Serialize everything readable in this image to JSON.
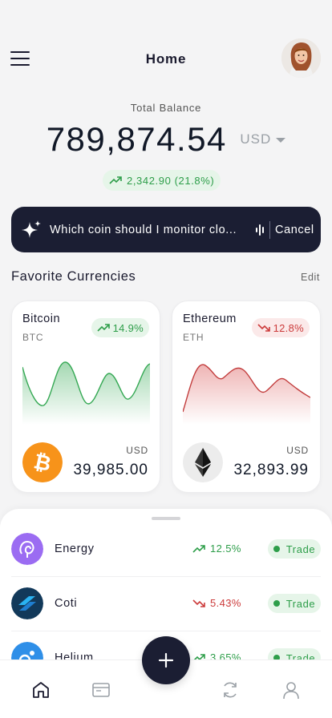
{
  "header": {
    "title": "Home"
  },
  "balance": {
    "label": "Total Balance",
    "amount": "789,874.54",
    "currency": "USD",
    "change": "2,342.90 (21.8%)"
  },
  "assistant": {
    "prompt": "Which coin should I monitor clo...",
    "cancel_label": "Cancel"
  },
  "favorites": {
    "title": "Favorite Currencies",
    "edit_label": "Edit",
    "cards": [
      {
        "name": "Bitcoin",
        "symbol": "BTC",
        "change": "14.9%",
        "trend": "up",
        "currency": "USD",
        "value": "39,985.00",
        "color": "#34a853",
        "icon": "bitcoin-icon"
      },
      {
        "name": "Ethereum",
        "symbol": "ETH",
        "change": "12.8%",
        "trend": "down",
        "currency": "USD",
        "value": "32,893.99",
        "color": "#d64545",
        "icon": "ethereum-icon"
      }
    ]
  },
  "assets": [
    {
      "name": "Energy",
      "change": "12.5%",
      "trend": "up",
      "action": "Trade",
      "icon": "energy-icon",
      "color": "#9b6cf2"
    },
    {
      "name": "Coti",
      "change": "5.43%",
      "trend": "down",
      "action": "Trade",
      "icon": "coti-icon",
      "color": "#12395a"
    },
    {
      "name": "Helium",
      "change": "3.65%",
      "trend": "up",
      "action": "Trade",
      "icon": "helium-icon",
      "color": "#2f8fe8"
    }
  ],
  "tabbar": {
    "items": [
      "home-icon",
      "wallet-icon",
      "add-icon",
      "exchange-icon",
      "profile-icon"
    ]
  },
  "colors": {
    "accent_dark": "#1b1e33",
    "positive": "#2e9e4a",
    "negative": "#cc3b3b"
  }
}
